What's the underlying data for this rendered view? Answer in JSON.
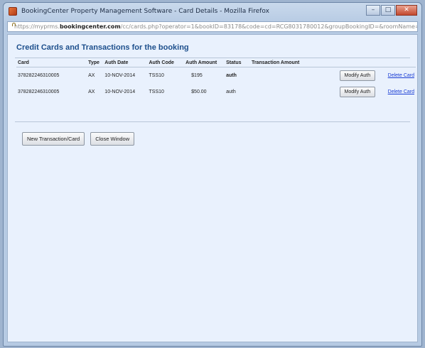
{
  "window": {
    "title": "BookingCenter Property Management Software - Card Details - Mozilla Firefox",
    "controls": {
      "minimize": "–",
      "maximize": "□",
      "close": "✕"
    }
  },
  "address_bar": {
    "url_prefix": "https://myprms.",
    "url_domain": "bookingcenter.com",
    "url_suffix": "/cc/cards.php?operator=1&bookID=83178&code=cd=RCG8031780012&groupBookingID=&roomName="
  },
  "page": {
    "title": "Credit Cards and Transactions for the booking",
    "columns": [
      "Card",
      "Type",
      "Auth Date",
      "Auth Code",
      "Auth Amount",
      "Status",
      "Transaction Amount"
    ],
    "rows": [
      {
        "card": "378282246310005",
        "type": "AX",
        "auth_date": "10-NOV-2014",
        "auth_code": "TSS10",
        "auth_amount": "$195",
        "status": "auth",
        "transaction_amount": "",
        "modify_label": "Modify Auth",
        "delete_label": "Delete Card"
      },
      {
        "card": "378282246310005",
        "type": "AX",
        "auth_date": "10-NOV-2014",
        "auth_code": "TSS10",
        "auth_amount": "$50.00",
        "status": "auth",
        "transaction_amount": "",
        "modify_label": "Modify Auth",
        "delete_label": "Delete Card"
      }
    ],
    "new_transaction_label": "New Transaction/Card",
    "close_window_label": "Close Window"
  }
}
